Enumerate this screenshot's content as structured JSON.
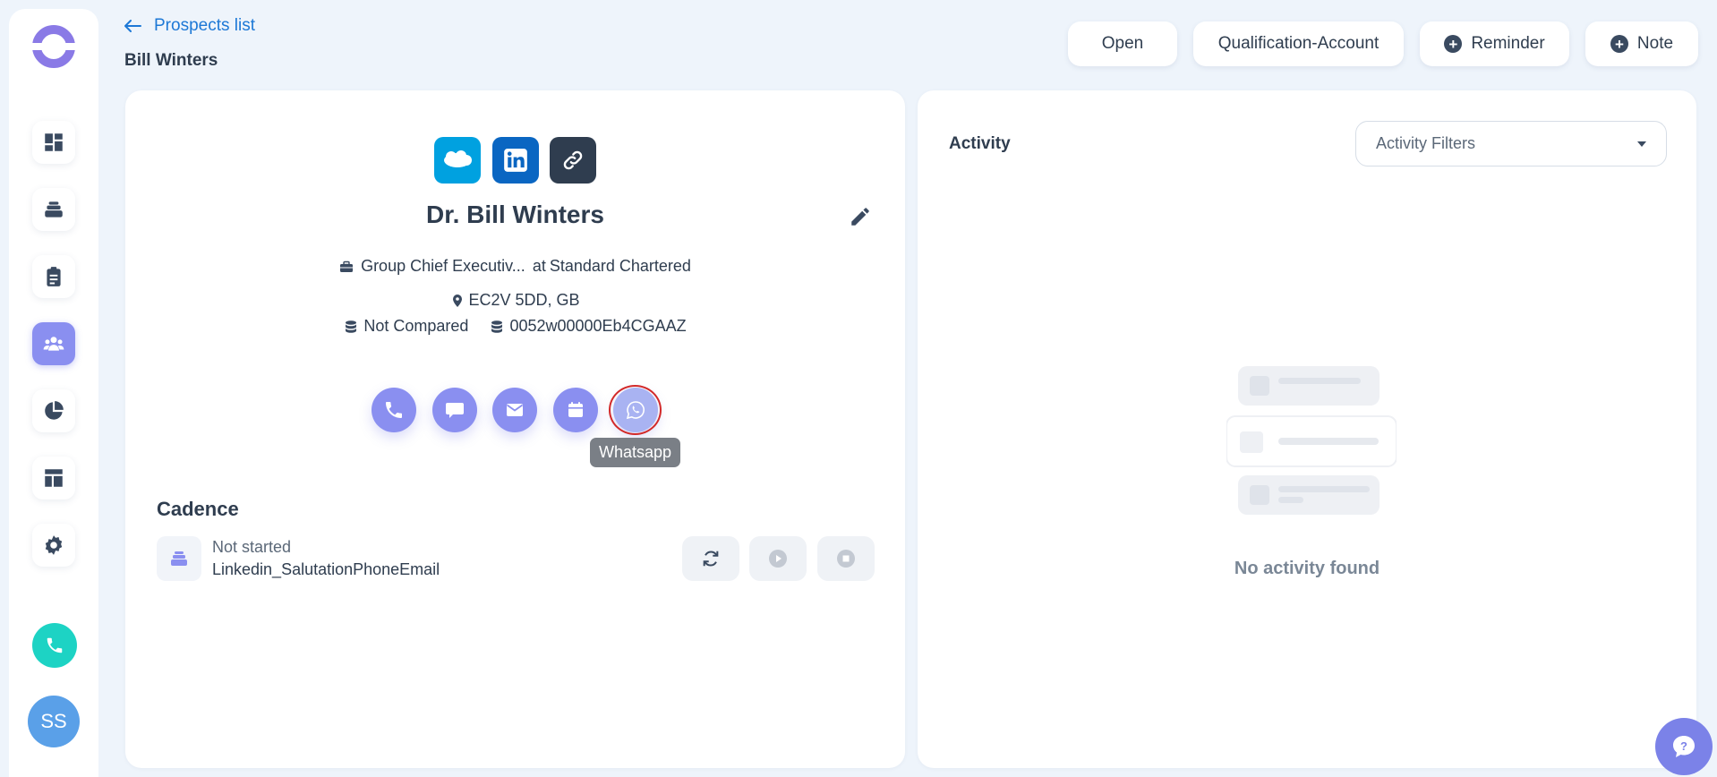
{
  "nav": {
    "back_label": "Prospects list",
    "page_title": "Bill Winters",
    "items": [
      {
        "name": "dashboard",
        "icon": "dashboard-icon"
      },
      {
        "name": "cadences",
        "icon": "layers-icon"
      },
      {
        "name": "tasks",
        "icon": "clipboard-icon"
      },
      {
        "name": "prospects",
        "icon": "users-icon",
        "active": true
      },
      {
        "name": "reports",
        "icon": "pie-chart-icon"
      },
      {
        "name": "templates",
        "icon": "layout-icon"
      },
      {
        "name": "settings",
        "icon": "gear-icon"
      }
    ],
    "avatar_initials": "SS"
  },
  "header": {
    "status_label": "Open",
    "stage_label": "Qualification-Account",
    "reminder_label": "Reminder",
    "note_label": "Note"
  },
  "prospect": {
    "name": "Dr. Bill Winters",
    "title": "Group Chief Executiv...",
    "company_prefix": "at",
    "company": "Standard Chartered",
    "location": "EC2V 5DD, GB",
    "compare_status": "Not Compared",
    "crm_id": "0052w00000Eb4CGAAZ",
    "social_icons": [
      "salesforce-icon",
      "linkedin-icon",
      "link-icon"
    ]
  },
  "actions": {
    "buttons": [
      "phone-icon",
      "chat-icon",
      "email-icon",
      "calendar-icon",
      "whatsapp-icon"
    ],
    "tooltip": "Whatsapp"
  },
  "cadence": {
    "title": "Cadence",
    "status": "Not started",
    "name": "Linkedin_SalutationPhoneEmail"
  },
  "activity": {
    "title": "Activity",
    "filter_placeholder": "Activity Filters",
    "empty_text": "No activity found"
  },
  "colors": {
    "accent": "#8a8ff0",
    "link": "#1d78d6",
    "call": "#1dd3c4",
    "salesforce": "#00a1e0",
    "linkedin": "#0a66c2",
    "highlight": "#d22a2a"
  }
}
